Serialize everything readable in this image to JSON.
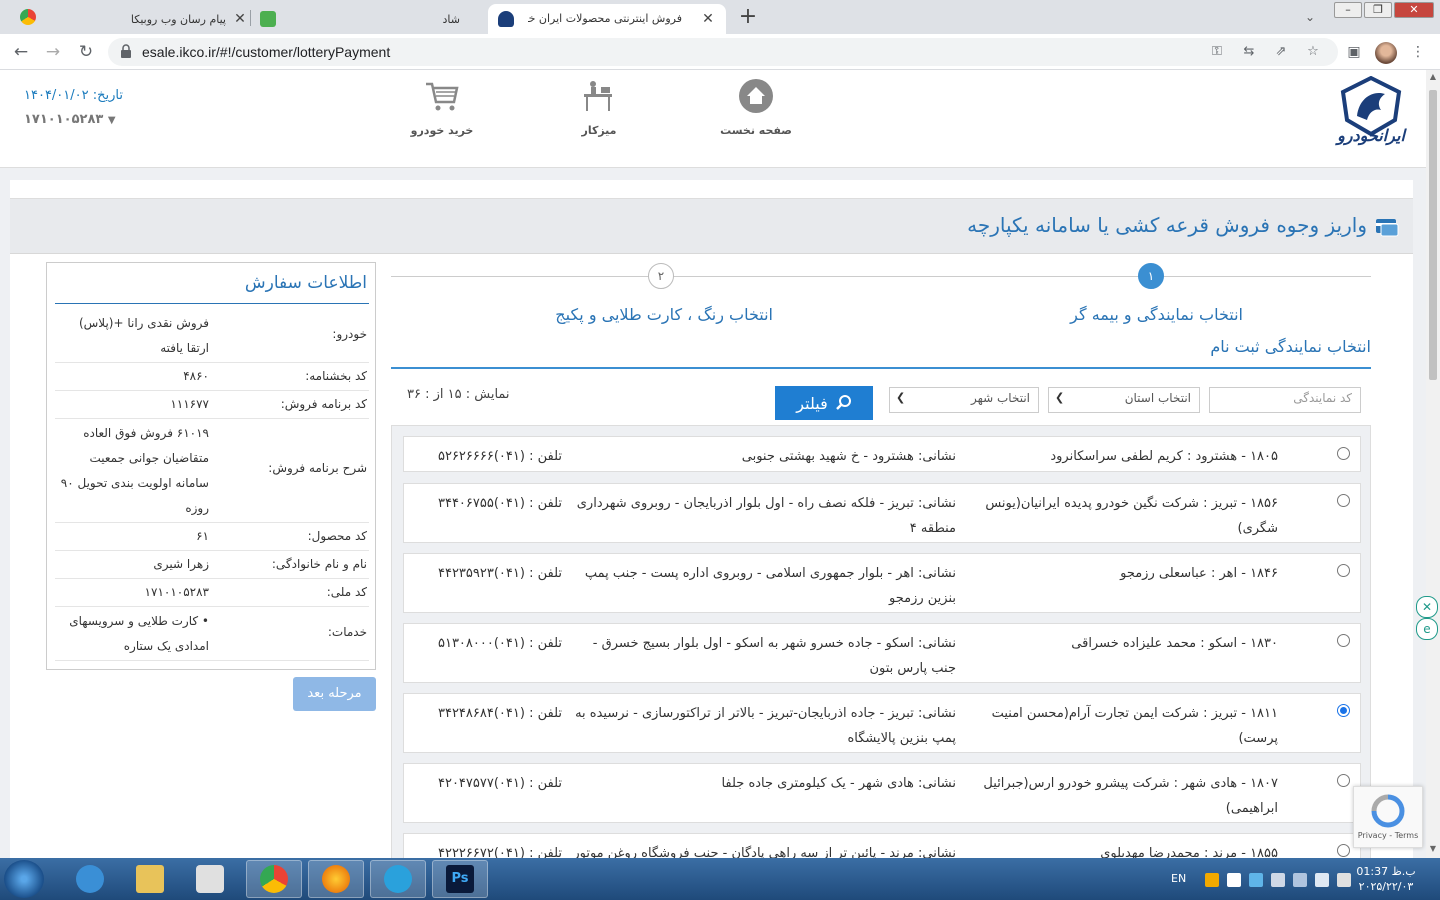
{
  "browser": {
    "tabs": [
      {
        "title": "فروش اینترنتی محصولات ایران خودرو",
        "active": true
      },
      {
        "title": "شاد",
        "active": false
      },
      {
        "title": "پیام رسان وب روبیکا",
        "active": false
      }
    ],
    "url": "esale.ikco.ir/#!/customer/lotteryPayment"
  },
  "header": {
    "nav": [
      {
        "label": "صفحه نخست",
        "icon": "home-icon"
      },
      {
        "label": "میزکار",
        "icon": "desk-icon"
      },
      {
        "label": "خرید خودرو",
        "icon": "cart-icon"
      }
    ],
    "date_label": "تاریخ: ۱۴۰۴/۰۱/۰۲",
    "national_id": "۱۷۱۰۱۰۵۲۸۳"
  },
  "page": {
    "title": "واریز وجوه فروش قرعه کشی یا سامانه یکپارچه",
    "steps": [
      {
        "number": "۱",
        "label": "انتخاب نمایندگی و بیمه گر"
      },
      {
        "number": "۲",
        "label": "انتخاب رنگ ، کارت طلایی و پکیج"
      }
    ],
    "section_title": "انتخاب نمایندگی ثبت نام"
  },
  "filters": {
    "agency_code_placeholder": "کد نمایندگی",
    "province_select": "انتخاب استان",
    "city_select": "انتخاب شهر",
    "filter_button": "فیلتر",
    "count_label": "نمایش : ۱۵ از : ۳۶"
  },
  "agencies": [
    {
      "name": "۱۸۰۵ - هشترود : کریم لطفی سراسکانرود",
      "address": "نشانی: هشترود - خ شهید بهشتی جنوبی",
      "phone": "تلفن : (۰۴۱)۵۲۶۲۶۶۶۶",
      "selected": false
    },
    {
      "name": "۱۸۵۶ - تبریز : شرکت نگین خودرو پدیده ایرانیان(یونس شگری)",
      "address": "نشانی: تبریز - فلکه نصف راه - اول بلوار اذربایجان - روبروی شهرداری منطقه ۴",
      "phone": "تلفن : (۰۴۱)۳۴۴۰۶۷۵۵",
      "selected": false
    },
    {
      "name": "۱۸۴۶ - اهر : عباسعلی رزمجو",
      "address": "نشانی: اهر - بلوار جمهوری اسلامی - روبروی اداره پست - جنب پمپ بنزین رزمجو",
      "phone": "تلفن : (۰۴۱)۴۴۲۳۵۹۲۳",
      "selected": false
    },
    {
      "name": "۱۸۳۰ - اسکو : محمد علیزاده خسراقی",
      "address": "نشانی: اسکو - جاده خسرو شهر به اسکو - اول بلوار بسیج خسرق - جنب پارس بتون",
      "phone": "تلفن : (۰۴۱)۵۱۳۰۸۰۰۰",
      "selected": false
    },
    {
      "name": "۱۸۱۱ - تبریز : شرکت ایمن تجارت آرام(محسن امنیت پرست)",
      "address": "نشانی: تبریز - جاده اذربایجان-تبریز - بالاتر از تراکتورسازی - نرسیده به پمپ بنزین پالایشگاه",
      "phone": "تلفن : (۰۴۱)۳۴۲۴۸۶۸۴",
      "selected": true
    },
    {
      "name": "۱۸۰۷ - هادی شهر : شرکت پیشرو خودرو ارس(جبرائیل ابراهیمی)",
      "address": "نشانی: هادی شهر - یک کیلومتری جاده جلفا",
      "phone": "تلفن : (۰۴۱)۴۲۰۴۷۵۷۷",
      "selected": false
    },
    {
      "name": "۱۸۵۵ - مرند : محمدرضا مهدیلوی",
      "address": "نشانی: مرند - پائین تر از سه راهی پادگان - جنب فروشگاه روغن موتور",
      "phone": "تلفن : (۰۴۱)۴۲۲۲۶۶۷۲",
      "selected": false
    }
  ],
  "order": {
    "title": "اطلاعات سفارش",
    "rows": [
      {
        "key": "خودرو:",
        "value": "فروش نقدی رانا +(پلاس) ارتقا یافته"
      },
      {
        "key": "کد بخشنامه:",
        "value": "۴۸۶۰"
      },
      {
        "key": "کد برنامه فروش:",
        "value": "۱۱۱۶۷۷"
      },
      {
        "key": "شرح برنامه فروش:",
        "value": "۶۱۰۱۹ فروش فوق العاده متقاضیان جوانی جمعیت سامانه اولویت بندی تحویل ۹۰ روزه"
      },
      {
        "key": "کد محصول:",
        "value": "۶۱"
      },
      {
        "key": "نام و نام خانوادگی:",
        "value": "زهرا شیری"
      },
      {
        "key": "کد ملی:",
        "value": "۱۷۱۰۱۰۵۲۸۳"
      },
      {
        "key": "خدمات:",
        "value": "کارت طلایی و سرویسهای امدادی یک ستاره"
      }
    ],
    "next_button": "مرحله بعد"
  },
  "recaptcha": {
    "text": "Privacy - Terms"
  },
  "taskbar": {
    "lang": "EN",
    "time": "01:37 ب.ظ",
    "date": "۲۰۲۵/۲۲/۰۳"
  },
  "colors": {
    "primary": "#2a74b5",
    "button": "#1f7ed2",
    "next_button": "#8fb8e6"
  }
}
